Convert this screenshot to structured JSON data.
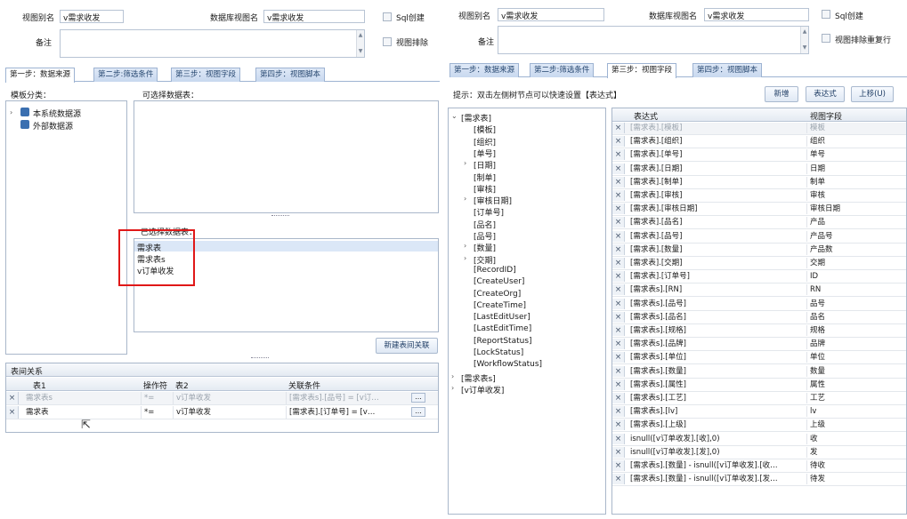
{
  "left": {
    "view_alias_label": "视图别名",
    "view_alias_value": "v需求收发",
    "db_view_label": "数据库视图名",
    "db_view_value": "v需求收发",
    "sql_build_label": "Sql创建",
    "remark_label": "备注",
    "sort_label": "视图排除",
    "tabs": [
      "第一步：数据来源",
      "第二步:筛选条件",
      "第三步：视图字段",
      "第四步：视图脚本"
    ],
    "category_label": "模板分类：",
    "source_tree": [
      "本系统数据源",
      "外部数据源"
    ],
    "available_tables_label": "可选择数据表：",
    "selected_tables_label": "已选择数据表：",
    "selected_tables": [
      "需求表",
      "需求表s",
      "v订单收发"
    ],
    "new_relation_button": "新建表间关联",
    "relations_title": "表间关系",
    "relations_headers": [
      "表1",
      "操作符",
      "表2",
      "关联条件"
    ],
    "relations": [
      {
        "t1": "需求表s",
        "op": "*=",
        "t2": "v订单收发",
        "cond": "[需求表s].[品号] = [v订…",
        "dim": true
      },
      {
        "t1": "需求表",
        "op": "*=",
        "t2": "v订单收发",
        "cond": "[需求表].[订单号] = [v…",
        "dim": false
      }
    ],
    "more_btn": "..."
  },
  "right": {
    "view_alias_label": "视图别名",
    "view_alias_value": "v需求收发",
    "db_view_label": "数据库视图名",
    "db_view_value": "v需求收发",
    "sql_build_label": "Sql创建",
    "remark_label": "备注",
    "sort_label": "视图排除重复行",
    "tabs": [
      "第一步：数据来源",
      "第二步:筛选条件",
      "第三步：视图字段",
      "第四步：视图脚本"
    ],
    "hint": "提示：双击左侧树节点可以快速设置【表达式】",
    "buttons": [
      "新增",
      "表达式",
      "上移(U)"
    ],
    "tree": [
      {
        "label": "[需求表]",
        "level": 0,
        "caret": "v"
      },
      {
        "label": "[模板]",
        "level": 1,
        "caret": ""
      },
      {
        "label": "[组织]",
        "level": 1,
        "caret": ""
      },
      {
        "label": "[单号]",
        "level": 1,
        "caret": ""
      },
      {
        "label": "[日期]",
        "level": 1,
        "caret": ">"
      },
      {
        "label": "[制单]",
        "level": 1,
        "caret": ""
      },
      {
        "label": "[审核]",
        "level": 1,
        "caret": ""
      },
      {
        "label": "[审核日期]",
        "level": 1,
        "caret": ">"
      },
      {
        "label": "[订单号]",
        "level": 1,
        "caret": ""
      },
      {
        "label": "[品名]",
        "level": 1,
        "caret": ""
      },
      {
        "label": "[品号]",
        "level": 1,
        "caret": ""
      },
      {
        "label": "[数量]",
        "level": 1,
        "caret": ">"
      },
      {
        "label": "[交期]",
        "level": 1,
        "caret": ">"
      },
      {
        "label": "[RecordID]",
        "level": 1,
        "caret": ""
      },
      {
        "label": "[CreateUser]",
        "level": 1,
        "caret": ""
      },
      {
        "label": "[CreateOrg]",
        "level": 1,
        "caret": ""
      },
      {
        "label": "[CreateTime]",
        "level": 1,
        "caret": ""
      },
      {
        "label": "[LastEditUser]",
        "level": 1,
        "caret": ""
      },
      {
        "label": "[LastEditTime]",
        "level": 1,
        "caret": ""
      },
      {
        "label": "[ReportStatus]",
        "level": 1,
        "caret": ""
      },
      {
        "label": "[LockStatus]",
        "level": 1,
        "caret": ""
      },
      {
        "label": "[WorkflowStatus]",
        "level": 1,
        "caret": ""
      },
      {
        "label": "[需求表s]",
        "level": 0,
        "caret": ">"
      },
      {
        "label": "[v订单收发]",
        "level": 0,
        "caret": ">"
      }
    ],
    "grid_headers": [
      "表达式",
      "视图字段"
    ],
    "grid_rows": [
      {
        "expr": "[需求表].[模板]",
        "field": "模板",
        "dim": true
      },
      {
        "expr": "[需求表].[组织]",
        "field": "组织",
        "dim": false
      },
      {
        "expr": "[需求表].[单号]",
        "field": "单号",
        "dim": false
      },
      {
        "expr": "[需求表].[日期]",
        "field": "日期",
        "dim": false
      },
      {
        "expr": "[需求表].[制单]",
        "field": "制单",
        "dim": false
      },
      {
        "expr": "[需求表].[审核]",
        "field": "审核",
        "dim": false
      },
      {
        "expr": "[需求表].[审核日期]",
        "field": "审核日期",
        "dim": false
      },
      {
        "expr": "[需求表].[品名]",
        "field": "产品",
        "dim": false
      },
      {
        "expr": "[需求表].[品号]",
        "field": "产品号",
        "dim": false
      },
      {
        "expr": "[需求表].[数量]",
        "field": "产品数",
        "dim": false
      },
      {
        "expr": "[需求表].[交期]",
        "field": "交期",
        "dim": false
      },
      {
        "expr": "[需求表].[订单号]",
        "field": "ID",
        "dim": false
      },
      {
        "expr": "[需求表s].[RN]",
        "field": "RN",
        "dim": false
      },
      {
        "expr": "[需求表s].[品号]",
        "field": "品号",
        "dim": false
      },
      {
        "expr": "[需求表s].[品名]",
        "field": "品名",
        "dim": false
      },
      {
        "expr": "[需求表s].[规格]",
        "field": "规格",
        "dim": false
      },
      {
        "expr": "[需求表s].[品牌]",
        "field": "品牌",
        "dim": false
      },
      {
        "expr": "[需求表s].[单位]",
        "field": "单位",
        "dim": false
      },
      {
        "expr": "[需求表s].[数量]",
        "field": "数量",
        "dim": false
      },
      {
        "expr": "[需求表s].[属性]",
        "field": "属性",
        "dim": false
      },
      {
        "expr": "[需求表s].[工艺]",
        "field": "工艺",
        "dim": false
      },
      {
        "expr": "[需求表s].[lv]",
        "field": "lv",
        "dim": false
      },
      {
        "expr": "[需求表s].[上级]",
        "field": "上级",
        "dim": false
      },
      {
        "expr": "isnull([v订单收发].[收],0)",
        "field": "收",
        "dim": false
      },
      {
        "expr": "isnull([v订单收发].[发],0)",
        "field": "发",
        "dim": false
      },
      {
        "expr": "[需求表s].[数量] - isnull([v订单收发].[收…",
        "field": "待收",
        "dim": false
      },
      {
        "expr": "[需求表s].[数量] - isnull([v订单收发].[发…",
        "field": "待发",
        "dim": false
      }
    ]
  },
  "colors": {
    "accent": "#e01818",
    "tab_bg": "#c8d8ef",
    "grid_header": "#e4eaf2"
  }
}
